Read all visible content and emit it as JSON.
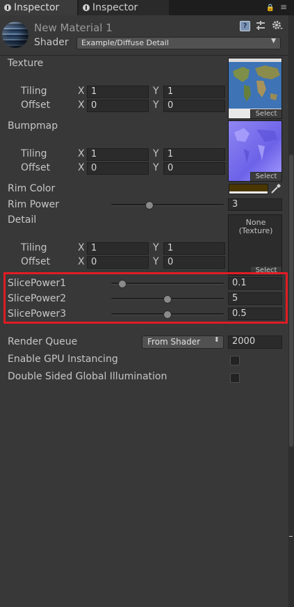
{
  "tabs": [
    {
      "label": "Inspector"
    },
    {
      "label": "Inspector"
    }
  ],
  "window_controls": {
    "lock": "🔒",
    "menu": "≡"
  },
  "header": {
    "material_name": "New Material 1",
    "shader_label": "Shader",
    "shader_value": "Example/Diffuse Detail",
    "icons": [
      "help-icon",
      "settings-sliders-icon",
      "gear-icon"
    ]
  },
  "texture": {
    "label": "Texture",
    "tiling_label": "Tiling",
    "offset_label": "Offset",
    "x_axis": "X",
    "y_axis": "Y",
    "tiling_x": "1",
    "tiling_y": "1",
    "offset_x": "0",
    "offset_y": "0",
    "select": "Select"
  },
  "bumpmap": {
    "label": "Bumpmap",
    "tiling_label": "Tiling",
    "offset_label": "Offset",
    "x_axis": "X",
    "y_axis": "Y",
    "tiling_x": "1",
    "tiling_y": "1",
    "offset_x": "0",
    "offset_y": "0",
    "select": "Select"
  },
  "rim_color": {
    "label": "Rim Color",
    "swatch": "#4a3700"
  },
  "rim_power": {
    "label": "Rim Power",
    "value": "3",
    "level": 0.34
  },
  "detail": {
    "label": "Detail",
    "empty_line1": "None",
    "empty_line2": "(Texture)",
    "tiling_label": "Tiling",
    "offset_label": "Offset",
    "x_axis": "X",
    "y_axis": "Y",
    "tiling_x": "1",
    "tiling_y": "1",
    "offset_x": "0",
    "offset_y": "0",
    "select": "Select"
  },
  "slice_powers": [
    {
      "label": "SlicePower1",
      "value": "0.1",
      "level": 0.1
    },
    {
      "label": "SlicePower2",
      "value": "5",
      "level": 0.5
    },
    {
      "label": "SlicePower3",
      "value": "0.5",
      "level": 0.5
    }
  ],
  "highlight_color": "#e01c24",
  "render_queue": {
    "label": "Render Queue",
    "dropdown": "From Shader",
    "value": "2000"
  },
  "gpu_instancing": {
    "label": "Enable GPU Instancing",
    "checked": false
  },
  "double_sided_gi": {
    "label": "Double Sided Global Illumination",
    "checked": false
  }
}
